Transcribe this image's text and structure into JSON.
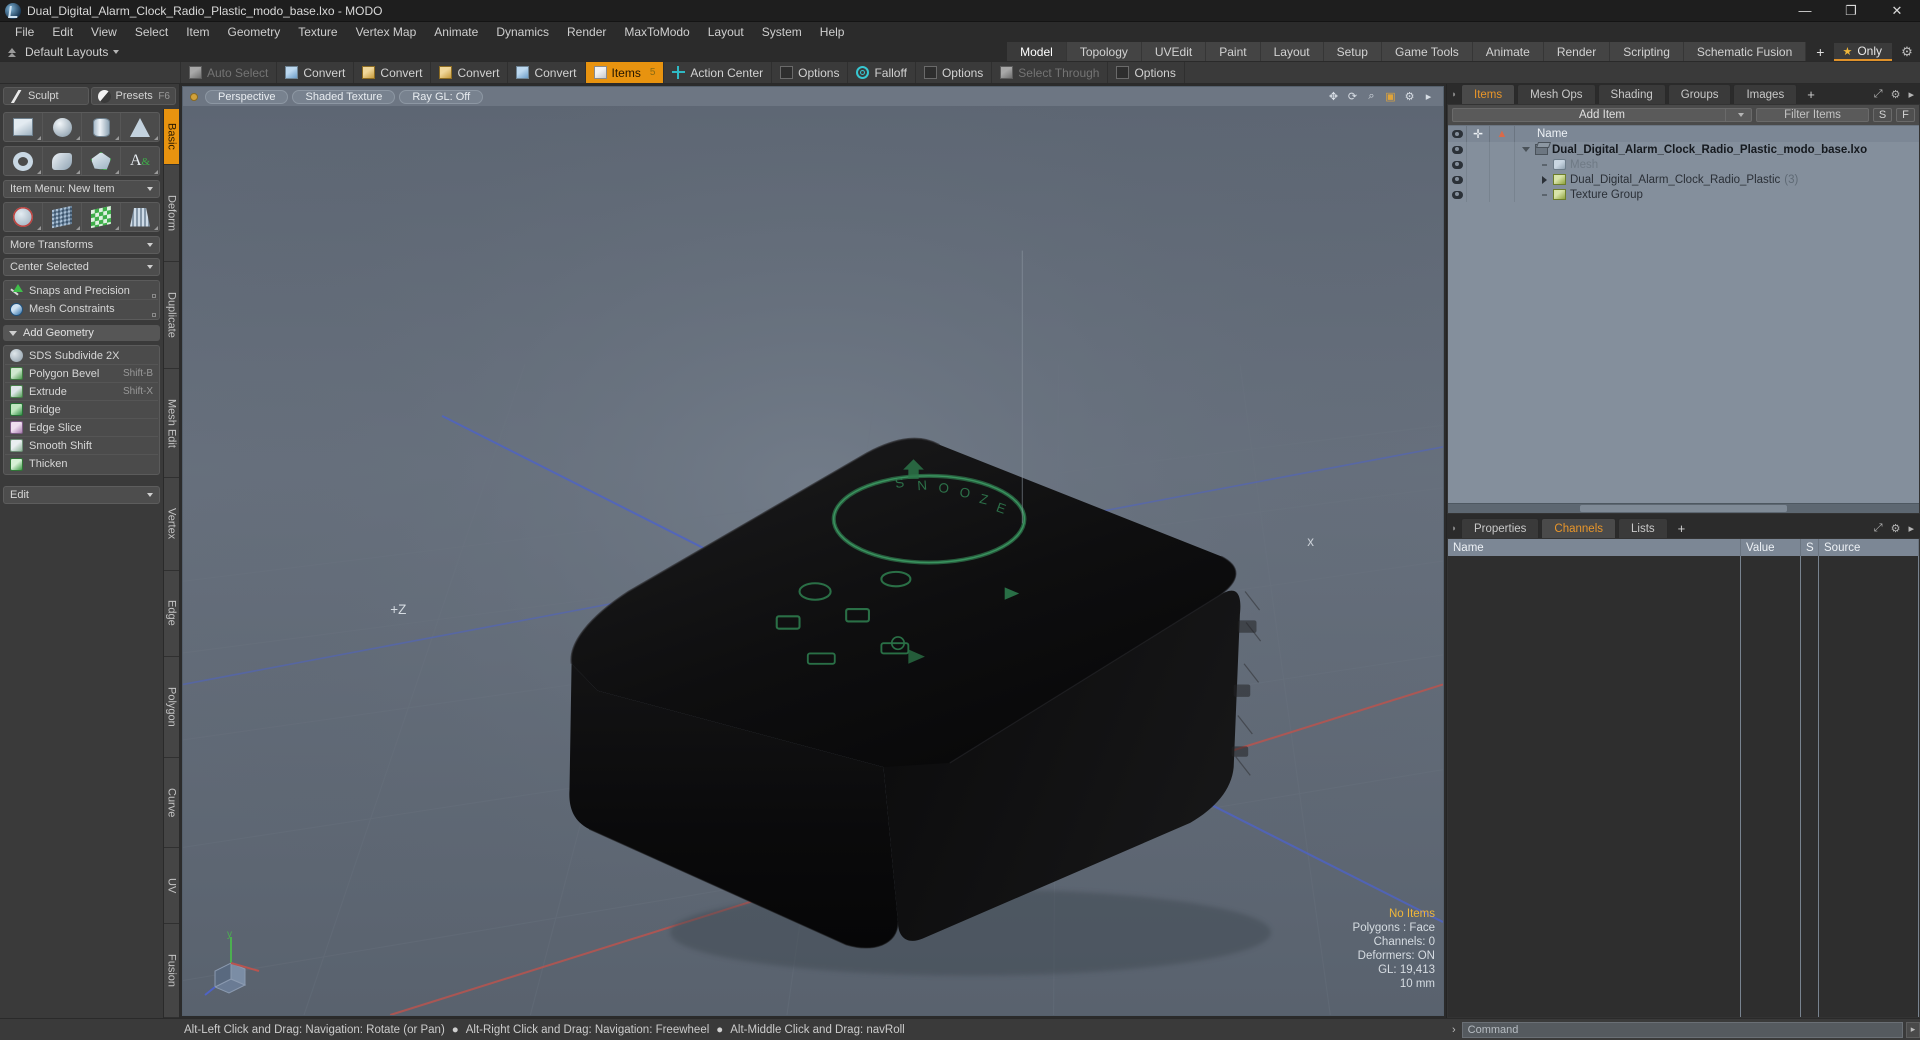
{
  "window": {
    "title": "Dual_Digital_Alarm_Clock_Radio_Plastic_modo_base.lxo - MODO",
    "minimize": "—",
    "maximize": "❐",
    "close": "✕"
  },
  "menubar": {
    "items": [
      "File",
      "Edit",
      "View",
      "Select",
      "Item",
      "Geometry",
      "Texture",
      "Vertex Map",
      "Animate",
      "Dynamics",
      "Render",
      "MaxToModo",
      "Layout",
      "System",
      "Help"
    ]
  },
  "layoutbar": {
    "preset_label": "Default Layouts",
    "tabs": [
      "Model",
      "Topology",
      "UVEdit",
      "Paint",
      "Layout",
      "Setup",
      "Game Tools",
      "Animate",
      "Render",
      "Scripting",
      "Schematic Fusion"
    ],
    "selected_tab": "Model",
    "add_tab": "+",
    "only_label": "Only",
    "star_icon": "★",
    "gear_icon": "⚙"
  },
  "modestrip": {
    "buttons": [
      {
        "label": "Auto Select",
        "icon": "cube-grey-icon",
        "state": "disabled"
      },
      {
        "label": "Convert",
        "icon": "cube-blue-icon",
        "state": "normal"
      },
      {
        "label": "Convert",
        "icon": "cube-gold-icon",
        "state": "normal"
      },
      {
        "label": "Convert",
        "icon": "cube-gold-icon",
        "state": "normal"
      },
      {
        "label": "Convert",
        "icon": "cube-blue-icon",
        "state": "normal"
      },
      {
        "label": "Items",
        "icon": "cube-white-icon",
        "state": "active",
        "badge": "5"
      },
      {
        "label": "Action Center",
        "icon": "crosshair-icon",
        "state": "normal"
      },
      {
        "label": "Options",
        "icon": "options-icon",
        "state": "normal"
      },
      {
        "label": "Falloff",
        "icon": "falloff-icon",
        "state": "normal"
      },
      {
        "label": "Options",
        "icon": "options-icon",
        "state": "normal"
      },
      {
        "label": "Select Through",
        "icon": "select-through-icon",
        "state": "disabled"
      },
      {
        "label": "Options",
        "icon": "options-icon",
        "state": "normal"
      }
    ]
  },
  "left_panel": {
    "sculpt": {
      "label": "Sculpt",
      "icon": "brush-icon"
    },
    "presets": {
      "label": "Presets",
      "shortcut": "F6",
      "icon": "sphere-icon"
    },
    "prim_row1": [
      "cube-icon",
      "sphere-icon",
      "cylinder-icon",
      "cone-icon"
    ],
    "prim_row2": [
      "torus-icon",
      "tube-icon",
      "polygon-icon",
      "text-icon"
    ],
    "item_menu": "Item Menu: New Item",
    "prim_row3": [
      "transform-icon",
      "grid-icon",
      "plane-icon",
      "fence-icon"
    ],
    "more_transforms": "More Transforms",
    "center_selected": "Center Selected",
    "snaps": {
      "label": "Snaps and Precision",
      "icon": "snap-icon"
    },
    "constraints": {
      "label": "Mesh Constraints",
      "icon": "constraint-icon"
    },
    "add_geometry_header": "Add Geometry",
    "geometry_tools": [
      {
        "label": "SDS Subdivide 2X",
        "shortcut": "",
        "icon": "sds-icon"
      },
      {
        "label": "Polygon Bevel",
        "shortcut": "Shift-B",
        "icon": "bevel-icon"
      },
      {
        "label": "Extrude",
        "shortcut": "Shift-X",
        "icon": "extrude-icon"
      },
      {
        "label": "Bridge",
        "shortcut": "",
        "icon": "bridge-icon"
      },
      {
        "label": "Edge Slice",
        "shortcut": "",
        "icon": "slice-icon"
      },
      {
        "label": "Smooth Shift",
        "shortcut": "",
        "icon": "smooth-icon"
      },
      {
        "label": "Thicken",
        "shortcut": "",
        "icon": "thicken-icon"
      }
    ],
    "edit_dropdown": "Edit",
    "vertical_tabs": [
      "Basic",
      "Deform",
      "Duplicate",
      "Mesh Edit",
      "Vertex",
      "Edge",
      "Polygon",
      "Curve",
      "UV",
      "Fusion"
    ],
    "vertical_selected": "Basic"
  },
  "viewport": {
    "header": {
      "view_mode": "Perspective",
      "shading_mode": "Shaded Texture",
      "raygl": "Ray GL: Off",
      "icons": [
        "move-view-icon",
        "rotate-view-icon",
        "zoom-view-icon",
        "fit-view-icon",
        "options-icon",
        "menu-icon"
      ]
    },
    "stats": {
      "selection": "No Items",
      "polygons": "Polygons : Face",
      "channels": "Channels: 0",
      "deformers": "Deformers: ON",
      "gl": "GL: 19,413",
      "grid": "10 mm"
    },
    "axis_labels": {
      "x": "X",
      "y": "Y",
      "z": "Z"
    },
    "plus_z_label": "+Z"
  },
  "items_panel": {
    "tabs": [
      "Items",
      "Mesh Ops",
      "Shading",
      "Groups",
      "Images"
    ],
    "selected_tab": "Items",
    "add_tab": "+",
    "add_item_label": "Add Item",
    "filter_placeholder": "Filter Items",
    "s_button": "S",
    "f_button": "F",
    "columns": [
      "Name"
    ],
    "rows": [
      {
        "name": "Dual_Digital_Alarm_Clock_Radio_Plastic_modo_base.lxo",
        "indent": 0,
        "style": "bold",
        "twirl": "down",
        "icon": "scene-icon",
        "count": ""
      },
      {
        "name": "Mesh",
        "indent": 1,
        "style": "dim",
        "twirl": "dash",
        "icon": "mesh-icon",
        "count": ""
      },
      {
        "name": "Dual_Digital_Alarm_Clock_Radio_Plastic",
        "indent": 1,
        "style": "normal",
        "twirl": "right",
        "icon": "folder-icon",
        "count": "(3)"
      },
      {
        "name": "Texture Group",
        "indent": 1,
        "style": "normal",
        "twirl": "dash",
        "icon": "folder-icon",
        "count": ""
      }
    ]
  },
  "channels_panel": {
    "tabs": [
      "Properties",
      "Channels",
      "Lists"
    ],
    "selected_tab": "Channels",
    "add_tab": "+",
    "columns": [
      "Name",
      "Value",
      "S",
      "Source"
    ],
    "rows": []
  },
  "statusbar": {
    "hints": [
      "Alt-Left Click and Drag: Navigation: Rotate (or Pan)",
      "Alt-Right Click and Drag: Navigation: Freewheel",
      "Alt-Middle Click and Drag: navRoll"
    ],
    "bullet": "●",
    "command_placeholder": "Command",
    "command_value": "",
    "command_prompt": "›"
  },
  "colors": {
    "accent_orange": "#e8930f",
    "panel_bg": "#3a3a3a",
    "viewport_bg": "#646e7b",
    "tree_bg": "#848f9c",
    "highlight_yellow": "#f0b73a"
  }
}
